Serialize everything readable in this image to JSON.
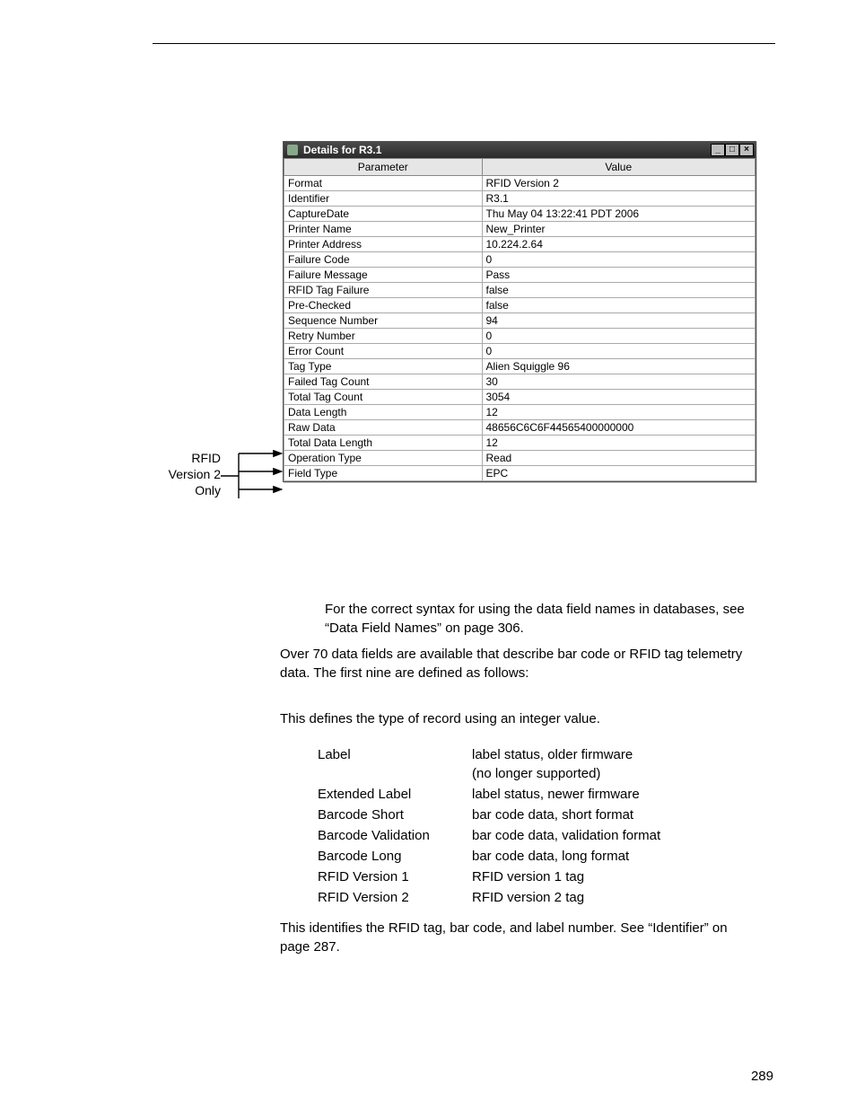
{
  "dialog": {
    "title": "Details for R3.1",
    "headers": {
      "param": "Parameter",
      "value": "Value"
    },
    "rows": [
      {
        "p": "Format",
        "v": "RFID Version 2"
      },
      {
        "p": "Identifier",
        "v": "R3.1"
      },
      {
        "p": "CaptureDate",
        "v": "Thu May 04 13:22:41 PDT 2006"
      },
      {
        "p": "Printer Name",
        "v": "New_Printer"
      },
      {
        "p": "Printer Address",
        "v": "10.224.2.64"
      },
      {
        "p": "Failure Code",
        "v": "0"
      },
      {
        "p": "Failure Message",
        "v": "Pass"
      },
      {
        "p": "RFID Tag Failure",
        "v": "false"
      },
      {
        "p": "Pre-Checked",
        "v": "false"
      },
      {
        "p": "Sequence Number",
        "v": "94"
      },
      {
        "p": "Retry Number",
        "v": "0"
      },
      {
        "p": "Error Count",
        "v": "0"
      },
      {
        "p": "Tag Type",
        "v": "Alien Squiggle 96"
      },
      {
        "p": "Failed Tag Count",
        "v": "30"
      },
      {
        "p": "Total Tag Count",
        "v": "3054"
      },
      {
        "p": "Data Length",
        "v": "12"
      },
      {
        "p": "Raw Data",
        "v": "48656C6C6F44565400000000"
      },
      {
        "p": "Total Data Length",
        "v": "12"
      },
      {
        "p": "Operation Type",
        "v": "Read"
      },
      {
        "p": "Field Type",
        "v": "EPC"
      }
    ]
  },
  "callout": "RFID\nVersion 2\nOnly",
  "note": "For the correct syntax for using the data field names in databases, see “Data Field Names” on page 306.",
  "over70": "Over 70 data fields are available that describe bar code or RFID tag telemetry data. The first nine are defined as follows:",
  "format_desc": "This defines the type of record using an integer value.",
  "format_rows": [
    {
      "l": "Label",
      "r": "label status, older firmware\n(no longer supported)"
    },
    {
      "l": "Extended Label",
      "r": "label status, newer firmware"
    },
    {
      "l": "Barcode Short",
      "r": "bar code data, short format"
    },
    {
      "l": "Barcode Validation",
      "r": "bar code data, validation format"
    },
    {
      "l": "Barcode Long",
      "r": "bar code data, long format"
    },
    {
      "l": "RFID Version 1",
      "r": "RFID version 1 tag"
    },
    {
      "l": "RFID Version 2",
      "r": "RFID version 2 tag"
    }
  ],
  "identifier_desc": "This identifies the RFID tag, bar code, and label number. See “Identifier” on page 287.",
  "page_number": "289"
}
